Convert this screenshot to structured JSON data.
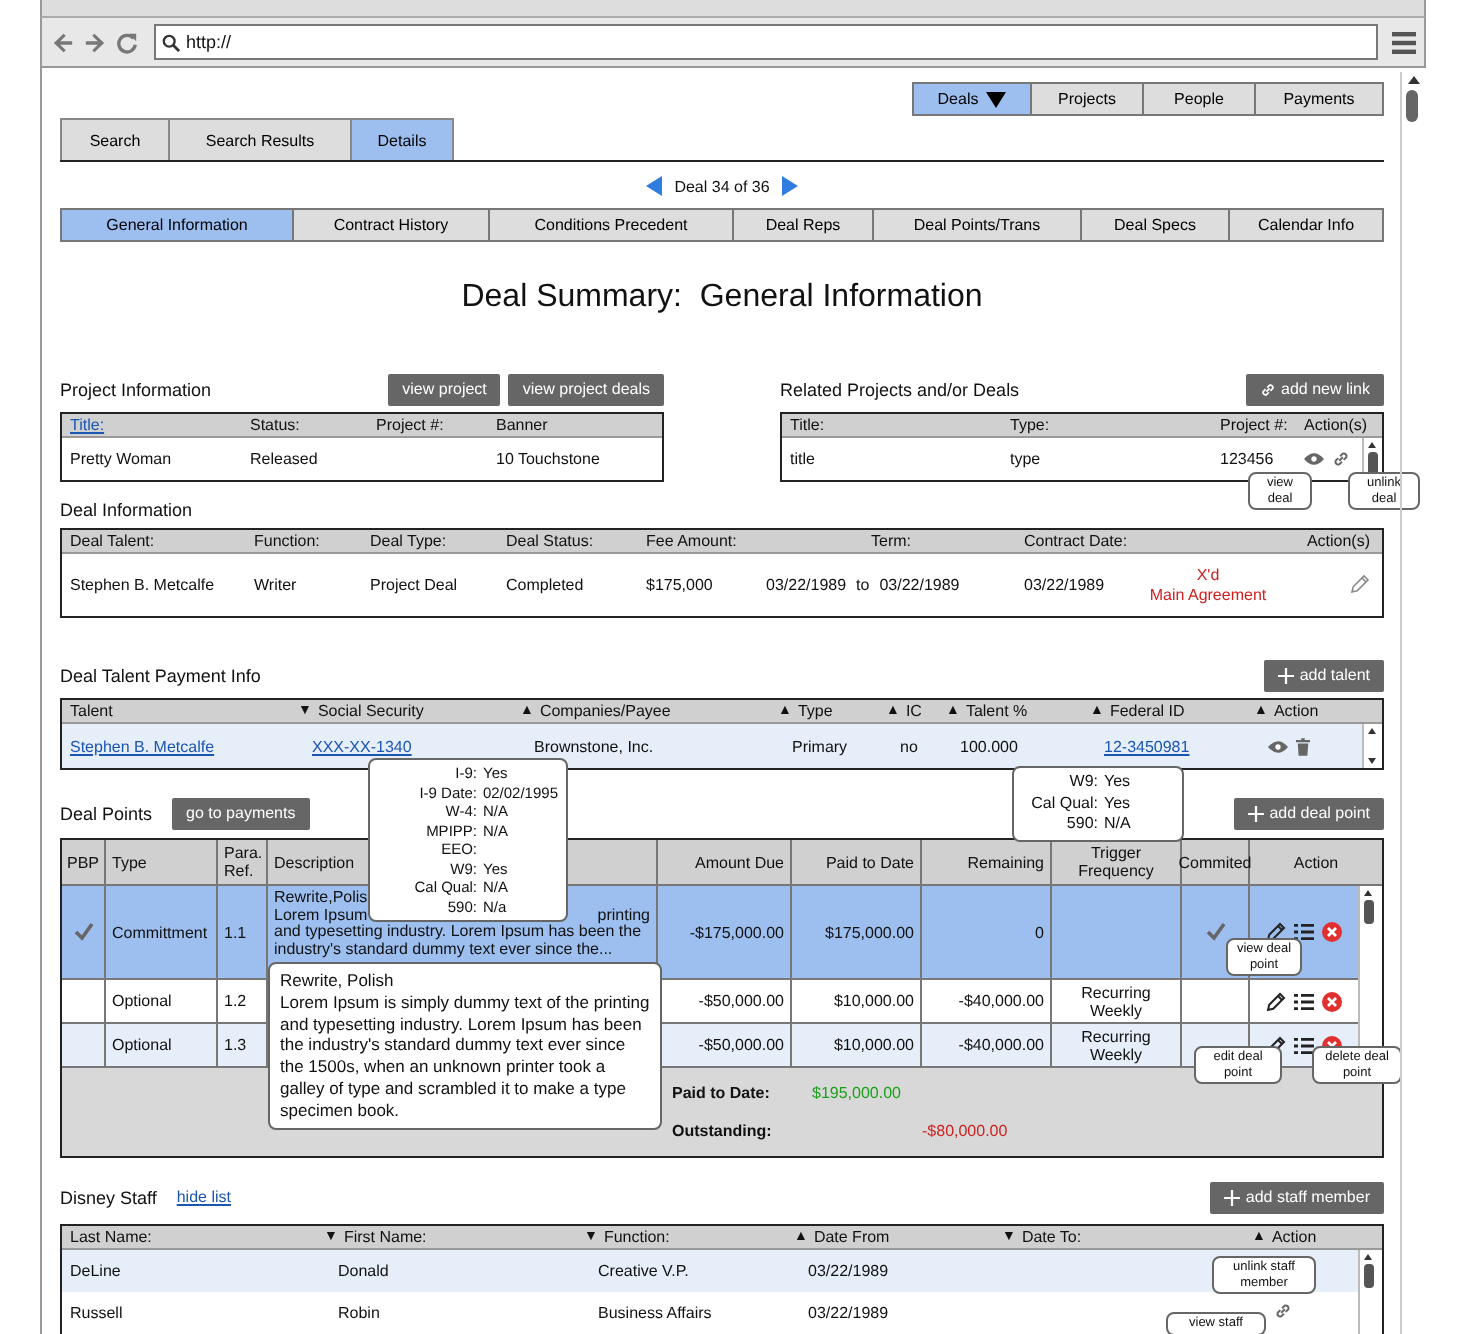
{
  "browser": {
    "url": "http://"
  },
  "top_nav": [
    {
      "label": "Deals",
      "selected": true,
      "menu": true
    },
    {
      "label": "Projects",
      "selected": false,
      "menu": false
    },
    {
      "label": "People",
      "selected": false,
      "menu": false
    },
    {
      "label": "Payments",
      "selected": false,
      "menu": false
    }
  ],
  "tabs": [
    {
      "label": "Search",
      "selected": false
    },
    {
      "label": "Search Results",
      "selected": false
    },
    {
      "label": "Details",
      "selected": true
    }
  ],
  "pager": {
    "label": "Deal 34 of 36"
  },
  "subtabs": [
    {
      "label": "General Information",
      "selected": true
    },
    {
      "label": "Contract History",
      "selected": false
    },
    {
      "label": "Conditions Precedent",
      "selected": false
    },
    {
      "label": "Deal Reps",
      "selected": false
    },
    {
      "label": "Deal Points/Trans",
      "selected": false
    },
    {
      "label": "Deal Specs",
      "selected": false
    },
    {
      "label": "Calendar Info",
      "selected": false
    }
  ],
  "title": "Deal Summary:  General Information",
  "project_info": {
    "heading": "Project Information",
    "buttons": [
      "view project",
      "view project deals"
    ],
    "columns": [
      {
        "label": "Title:",
        "link": true
      },
      {
        "label": "Status:",
        "link": false
      },
      {
        "label": "Project #:",
        "link": false
      },
      {
        "label": "Banner",
        "link": false
      }
    ],
    "rows": [
      {
        "title": "Pretty Woman",
        "status": "Released",
        "banner": "10 Touchstone"
      }
    ]
  },
  "related": {
    "heading": "Related Projects and/or Deals",
    "button": "add new link",
    "columns": [
      "Title:",
      "Type:",
      "Project #:",
      "Action(s)"
    ],
    "rows": [
      {
        "title": "title",
        "type": "type",
        "project": "123456"
      }
    ],
    "tooltips": [
      "view deal",
      "unlink deal"
    ]
  },
  "deal_info": {
    "heading": "Deal Information",
    "columns": [
      "Deal Talent:",
      "Function:",
      "Deal Type:",
      "Deal Status:",
      "Fee Amount:",
      "Term:",
      "Contract Date:",
      "Action(s)"
    ],
    "rows": [
      {
        "talent": "Stephen B. Metcalfe",
        "function": "Writer",
        "type": "Project Deal",
        "status": "Completed",
        "fee": "$175,000",
        "term_from": "03/22/1989",
        "term_joiner": "to",
        "term_to": "03/22/1989",
        "contract_date": "03/22/1989",
        "notes": [
          "X'd",
          "Main Agreement"
        ]
      }
    ]
  },
  "payment": {
    "heading": "Deal Talent Payment Info",
    "button": "add talent",
    "columns": [
      {
        "label": "Talent"
      },
      {
        "label": "Social Security",
        "marker": "▼"
      },
      {
        "label": "Companies/Payee",
        "marker": "▲"
      },
      {
        "label": "Type",
        "marker": "▲"
      },
      {
        "label": "IC",
        "marker": "▲"
      },
      {
        "label": "Talent %",
        "marker": "▲"
      },
      {
        "label": "Federal ID",
        "marker": "▲"
      },
      {
        "label": "Action",
        "marker": "▲"
      }
    ],
    "rows": [
      {
        "talent": "Stephen B. Metcalfe",
        "ssn": "XXX-XX-1340",
        "company": "Brownstone, Inc.",
        "type": "Primary",
        "ic": "no",
        "percent": "100.000",
        "federal_id": "12-3450981"
      }
    ],
    "ssn_tooltip": [
      {
        "label": "I-9:",
        "value": "Yes"
      },
      {
        "label": "I-9 Date:",
        "value": "02/02/1995"
      },
      {
        "label": "W-4:",
        "value": "N/A"
      },
      {
        "label": "MPIPP:",
        "value": "N/A"
      },
      {
        "label": "EEO:"
      },
      {
        "label": "W9:",
        "value": "Yes"
      },
      {
        "label": "Cal Qual:",
        "value": "N/A"
      },
      {
        "label": "590:",
        "value": "N/a"
      }
    ],
    "federal_tooltip": [
      {
        "label": "W9:",
        "value": "Yes"
      },
      {
        "label": "Cal Qual:",
        "value": "Yes"
      },
      {
        "label": "590:",
        "value": "N/A"
      }
    ]
  },
  "deal_points": {
    "heading": "Deal Points",
    "button": "go to payments",
    "add_button": "add deal point",
    "columns": [
      "PBP",
      "Type",
      "Para. Ref.",
      "Description",
      "Amount Due",
      "Paid to Date",
      "Remaining",
      "Trigger Frequency",
      "Commited",
      "Action"
    ],
    "rows": [
      {
        "pbp": true,
        "type": "Committment",
        "para": "1.1",
        "description": [
          [
            "Rewrite,Polis"
          ],
          [
            "Lorem Ipsum",
            "printing"
          ],
          [
            "and typesetting industry. Lorem Ipsum has been the"
          ],
          [
            "industry's standard dummy text ever since the..."
          ]
        ],
        "amount_due": "-$175,000.00",
        "paid": "$175,000.00",
        "remaining": "0",
        "committed": true,
        "selected": true
      },
      {
        "pbp": false,
        "type": "Optional",
        "para": "1.2",
        "amount_due": "-$50,000.00",
        "paid": "$10,000.00",
        "remaining": "-$40,000.00",
        "trigger": "Recurring Weekly",
        "committed": false,
        "selected": false
      },
      {
        "pbp": false,
        "type": "Optional",
        "para": "1.3",
        "amount_due": "-$50,000.00",
        "paid": "$10,000.00",
        "remaining": "-$40,000.00",
        "trigger": "Recurring Weekly",
        "committed": false,
        "selected": false
      }
    ],
    "summary": {
      "paid_label": "Paid to Date:",
      "paid_value": "$195,000.00",
      "outstanding_label": "Outstanding:",
      "outstanding_value": "-$80,000.00"
    },
    "description_tooltip": {
      "title": "Rewrite, Polish",
      "body": "Lorem Ipsum is simply dummy text of the printing and typesetting industry. Lorem Ipsum has been the industry's standard dummy text ever since the 1500s, when an unknown printer took a galley of type and scrambled it to make a type specimen book."
    },
    "action_tooltips": [
      "view deal point",
      "edit deal point",
      "delete deal point"
    ]
  },
  "staff": {
    "heading": "Disney Staff",
    "link": "hide list",
    "button": "add staff member",
    "columns": [
      {
        "label": "Last Name:"
      },
      {
        "label": "First Name:",
        "marker": "▼"
      },
      {
        "label": "Function:",
        "marker": "▼"
      },
      {
        "label": "Date From",
        "marker": "▲"
      },
      {
        "label": "Date To:",
        "marker": "▼"
      },
      {
        "label": "Action",
        "marker": "▲"
      }
    ],
    "rows": [
      {
        "last": "DeLine",
        "first": "Donald",
        "function": "Creative V.P.",
        "from": "03/22/1989"
      },
      {
        "last": "Russell",
        "first": "Robin",
        "function": "Business Affairs",
        "from": "03/22/1989",
        "actions": [
          {
            "kind": "link"
          }
        ]
      }
    ],
    "tooltips": [
      "unlink staff member",
      "view staff"
    ]
  }
}
